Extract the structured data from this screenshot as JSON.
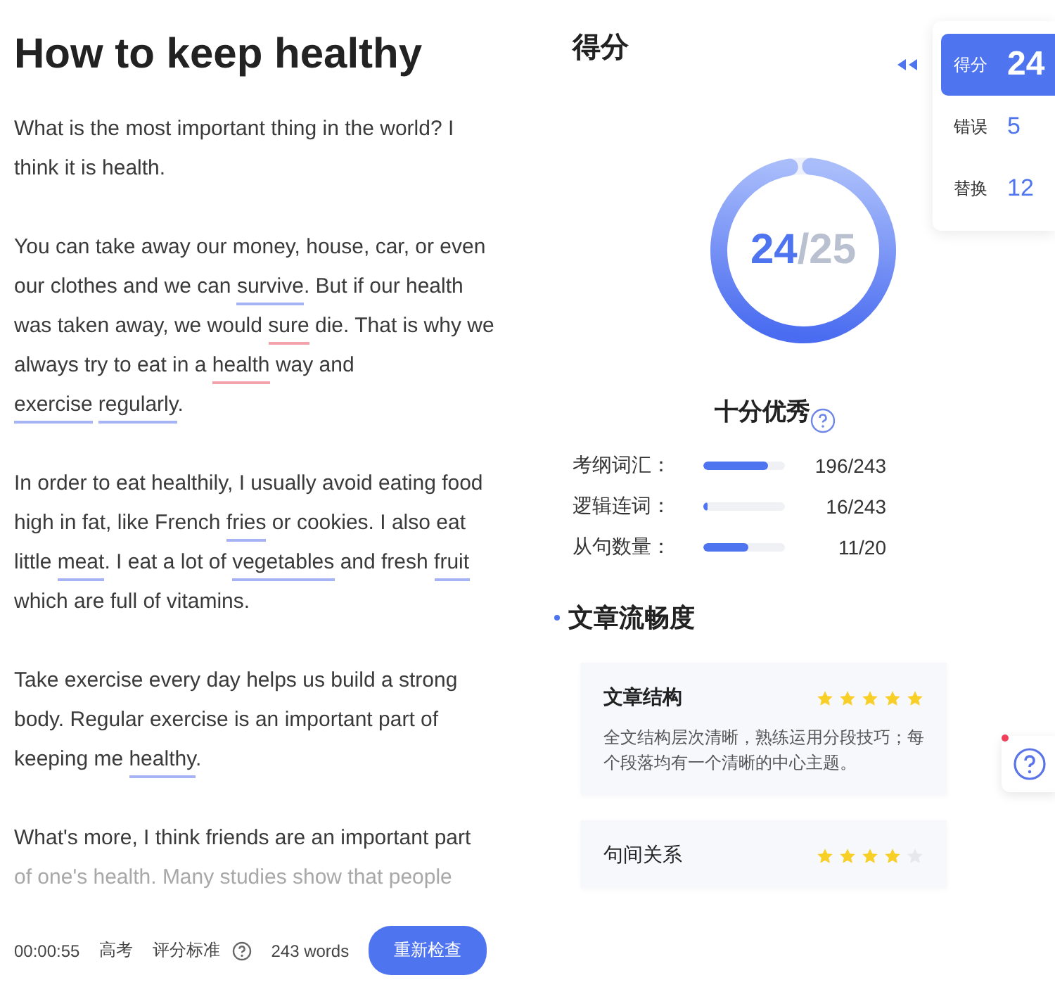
{
  "essay": {
    "title": "How to keep healthy",
    "paragraphs": [
      [
        {
          "text": "What is the most important thing in the world? I think it is health.",
          "kind": "plain"
        }
      ],
      [
        {
          "text": "You can take away our money, house, car, or even our clothes and we can ",
          "kind": "plain"
        },
        {
          "text": "survive",
          "kind": "good"
        },
        {
          "text": ". But if our health was taken away, we would ",
          "kind": "plain"
        },
        {
          "text": "sure",
          "kind": "error"
        },
        {
          "text": " die. That is why we always try to eat in a ",
          "kind": "plain"
        },
        {
          "text": "health",
          "kind": "error"
        },
        {
          "text": " way and ",
          "kind": "plain"
        },
        {
          "text": "exercise",
          "kind": "good"
        },
        {
          "text": "regularly",
          "kind": "good",
          "space_before": true
        },
        {
          "text": ".",
          "kind": "plain"
        }
      ],
      [
        {
          "text": "In order to eat healthily, I usually avoid eating food high in fat, like French ",
          "kind": "plain"
        },
        {
          "text": "fries",
          "kind": "good"
        },
        {
          "text": " or cookies. I also eat little ",
          "kind": "plain"
        },
        {
          "text": "meat",
          "kind": "good"
        },
        {
          "text": ". I eat a lot of ",
          "kind": "plain"
        },
        {
          "text": "vegetables",
          "kind": "good"
        },
        {
          "text": " and fresh ",
          "kind": "plain"
        },
        {
          "text": "fruit",
          "kind": "good"
        },
        {
          "text": " which are full of vitamins.",
          "kind": "plain"
        }
      ],
      [
        {
          "text": "Take exercise every day helps us build a strong body. Regular exercise is an important part of keeping me ",
          "kind": "plain"
        },
        {
          "text": "healthy",
          "kind": "good"
        },
        {
          "text": ".",
          "kind": "plain"
        }
      ],
      [
        {
          "text": "What's more, I think friends are an important part",
          "kind": "plain"
        }
      ]
    ],
    "faded_line": "of one's health. Many studies show that people"
  },
  "footer": {
    "time": "00:00:55",
    "exam": "高考",
    "criteria": "评分标准",
    "word_count": "243 words",
    "button": "重新检查"
  },
  "score": {
    "heading": "得分",
    "value": "24",
    "total": "/25",
    "level": 0.96,
    "rating": "十分优秀"
  },
  "metrics": [
    {
      "label": "考纲词汇：",
      "level": 0.8,
      "reading": "196/243"
    },
    {
      "label": "逻辑连词：",
      "level": 0.06,
      "reading": "16/243"
    },
    {
      "label": "从句数量：",
      "level": 0.55,
      "reading": "11/20"
    }
  ],
  "fluency": {
    "heading": "文章流畅度",
    "cards": [
      {
        "title": "文章结构",
        "stars": 5,
        "text": "全文结构层次清晰，熟练运用分段技巧；每个段落均有一个清晰的中心主题。"
      },
      {
        "title": "句间关系",
        "stars": 4
      }
    ]
  },
  "side_panel": {
    "tabs": [
      {
        "label": "得分",
        "count": "24",
        "selected": true
      },
      {
        "label": "错误",
        "count": "5",
        "selected": false
      },
      {
        "label": "替换",
        "count": "12",
        "selected": false
      }
    ]
  }
}
